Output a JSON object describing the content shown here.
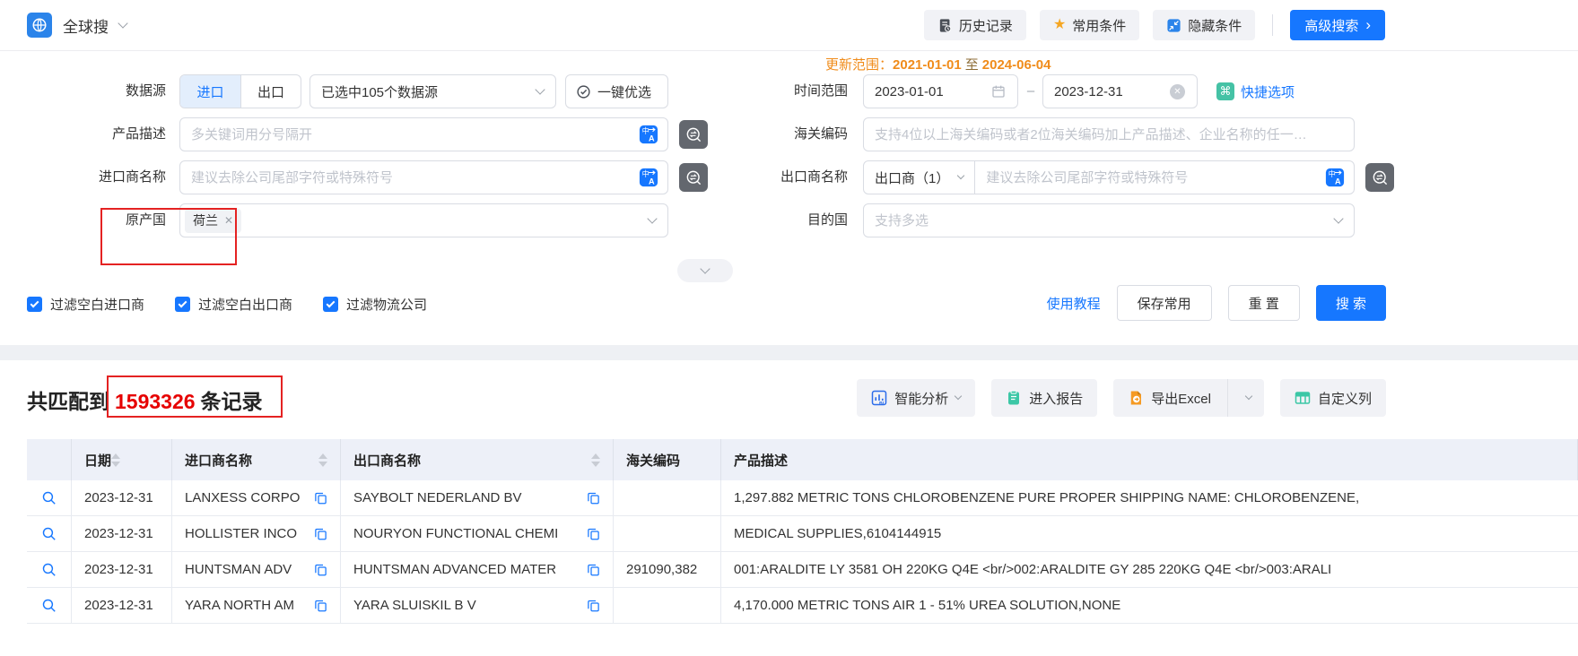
{
  "topbar": {
    "app_name": "全球搜",
    "history": "历史记录",
    "favorites": "常用条件",
    "hide": "隐藏条件",
    "advanced": "高级搜索"
  },
  "update_range": {
    "label": "更新范围：",
    "from": "2021-01-01",
    "to_word": "至",
    "to": "2024-06-04"
  },
  "form": {
    "data_source": {
      "label": "数据源",
      "tab_import": "进口",
      "tab_export": "出口",
      "selected": "已选中105个数据源",
      "optimize": "一键优选"
    },
    "time_range": {
      "label": "时间范围",
      "from": "2023-01-01",
      "dash": "–",
      "to": "2023-12-31",
      "quick": "快捷选项"
    },
    "product_desc": {
      "label": "产品描述",
      "placeholder": "多关键词用分号隔开"
    },
    "hs_code": {
      "label": "海关编码",
      "placeholder": "支持4位以上海关编码或者2位海关编码加上产品描述、企业名称的任一…"
    },
    "importer": {
      "label": "进口商名称",
      "placeholder": "建议去除公司尾部字符或特殊符号"
    },
    "exporter": {
      "label": "出口商名称",
      "type_selector": "出口商（1）",
      "placeholder": "建议去除公司尾部字符或特殊符号"
    },
    "origin": {
      "label": "原产国",
      "tag": "荷兰"
    },
    "destination": {
      "label": "目的国",
      "placeholder": "支持多选"
    },
    "filters": [
      {
        "label": "过滤空白进口商",
        "checked": true
      },
      {
        "label": "过滤空白出口商",
        "checked": true
      },
      {
        "label": "过滤物流公司",
        "checked": true
      }
    ],
    "actions": {
      "tutorial": "使用教程",
      "save": "保存常用",
      "reset": "重 置",
      "search": "搜 索"
    }
  },
  "results": {
    "prefix": "共匹配到",
    "count": "1593326",
    "suffix": "条记录",
    "buttons": {
      "analyze": "智能分析",
      "report": "进入报告",
      "export": "导出Excel",
      "columns": "自定义列"
    }
  },
  "table": {
    "headers": {
      "date": "日期",
      "importer": "进口商名称",
      "exporter": "出口商名称",
      "hs_code": "海关编码",
      "product": "产品描述"
    },
    "rows": [
      {
        "date": "2023-12-31",
        "importer": "LANXESS CORPO",
        "exporter": "SAYBOLT NEDERLAND BV",
        "hs_code": "",
        "product": "1,297.882 METRIC TONS CHLOROBENZENE PURE PROPER SHIPPING NAME: CHLOROBENZENE,"
      },
      {
        "date": "2023-12-31",
        "importer": "HOLLISTER INCO",
        "exporter": "NOURYON FUNCTIONAL CHEMI",
        "hs_code": "",
        "product": "MEDICAL SUPPLIES,6104144915"
      },
      {
        "date": "2023-12-31",
        "importer": "HUNTSMAN ADV",
        "exporter": "HUNTSMAN ADVANCED MATER",
        "hs_code": "291090,382",
        "product": "001:ARALDITE LY 3581 OH 220KG Q4E <br/>002:ARALDITE GY 285 220KG Q4E <br/>003:ARALI"
      },
      {
        "date": "2023-12-31",
        "importer": "YARA NORTH AM",
        "exporter": "YARA SLUISKIL B V",
        "hs_code": "",
        "product": "4,170.000 METRIC TONS AIR 1 - 51% UREA SOLUTION,NONE"
      }
    ]
  },
  "icons": {
    "star": "★",
    "command": "⌘",
    "close": "✕",
    "translate": "中A",
    "arrow_right": "›"
  },
  "colors": {
    "primary": "#1677ff",
    "orange": "#f08c1b",
    "annotation_red": "#e42222",
    "count_red": "#e60000",
    "teal": "#45c2a5"
  }
}
